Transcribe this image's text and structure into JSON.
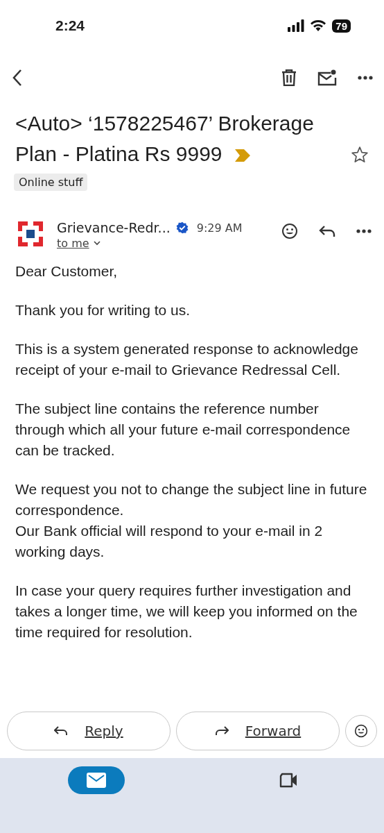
{
  "status_bar": {
    "time": "2:24",
    "battery": "79"
  },
  "subject": {
    "text": "<Auto> ‘1578225467’ Brokerage Plan - Platina Rs 9999",
    "important": true,
    "starred": false
  },
  "labels": [
    "Online stuff"
  ],
  "message": {
    "sender": "Grievance-Redr...",
    "verified": true,
    "time": "9:29 AM",
    "recipient": "to me"
  },
  "body": [
    [
      "Dear Customer,"
    ],
    [
      "Thank you for writing to us."
    ],
    [
      "This is a system generated response to acknowledge receipt of your e-mail to Grievance Redressal Cell."
    ],
    [
      "The subject line contains the reference number through which all your future e-mail correspondence can be tracked."
    ],
    [
      "We request you not to change the subject line in future correspondence.",
      "Our Bank official will respond to your e-mail in 2 working days."
    ],
    [
      "In case your query requires further investigation and takes a longer time, we will keep you informed on the time required for resolution."
    ]
  ],
  "actions": [
    {
      "kind": "reply",
      "label": "Reply"
    },
    {
      "kind": "forward",
      "label": "Forward"
    }
  ],
  "nav": [
    {
      "kind": "mail",
      "selected": true
    },
    {
      "kind": "video",
      "selected": false
    }
  ]
}
